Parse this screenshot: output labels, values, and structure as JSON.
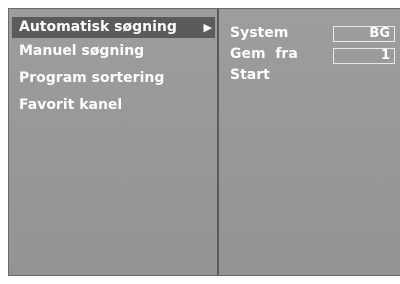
{
  "menu": {
    "items": [
      {
        "label": "Automatisk søgning",
        "selected": true,
        "arrow": "▶"
      },
      {
        "label": "Manuel søgning"
      },
      {
        "label": "Program sortering"
      },
      {
        "label": "Favorit kanel"
      }
    ]
  },
  "submenu": {
    "system": {
      "label": "System",
      "value": "BG"
    },
    "store_from": {
      "label": "Gem  fra",
      "value": "1"
    },
    "start": {
      "label": "Start"
    }
  },
  "colors": {
    "panel_bg": "#999999",
    "selected_bg": "#5b5b5b",
    "text": "#ffffff",
    "divider": "#5a5a5a"
  }
}
